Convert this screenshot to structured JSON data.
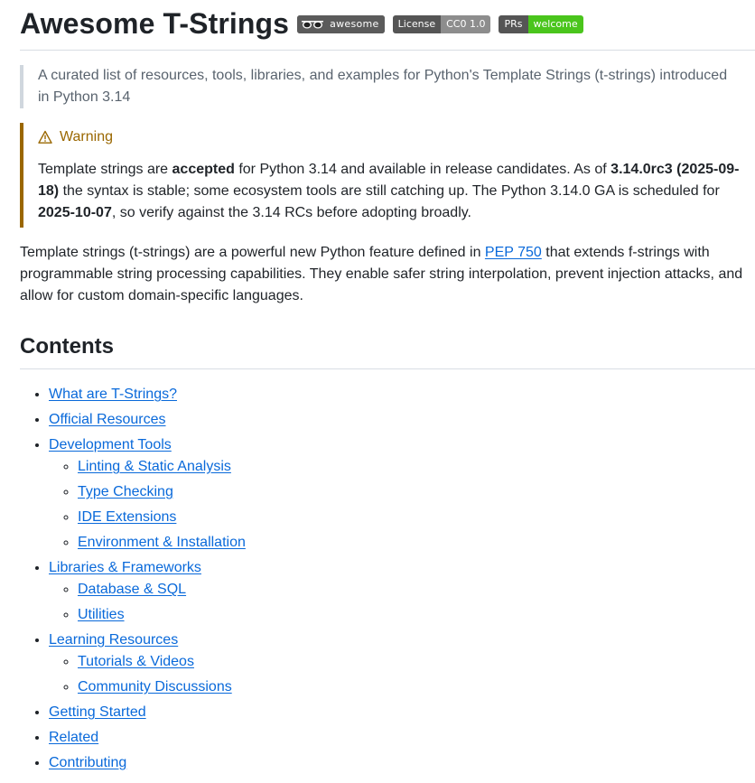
{
  "title": "Awesome T-Strings",
  "badges": [
    {
      "type": "awesome",
      "label": "awesome",
      "icon": "sunglasses-icon"
    },
    {
      "type": "license",
      "left": "License",
      "right": "CC0 1.0",
      "color": "#8d8d8d"
    },
    {
      "type": "prs",
      "left": "PRs",
      "right": "welcome",
      "color": "#4ac51c"
    }
  ],
  "intro": "A curated list of resources, tools, libraries, and examples for Python's Template Strings (t-strings) introduced in Python 3.14",
  "warning": {
    "title": "Warning",
    "t1": "Template strings are ",
    "b1": "accepted",
    "t2": " for Python 3.14 and available in release candidates. As of ",
    "b2": "3.14.0rc3 (2025-09-18)",
    "t3": " the syntax is stable; some ecosystem tools are still catching up. The Python 3.14.0 GA is scheduled for ",
    "b3": "2025-10-07",
    "t4": ", so verify against the 3.14 RCs before adopting broadly."
  },
  "description": {
    "before": "Template strings (t-strings) are a powerful new Python feature defined in ",
    "link": "PEP 750",
    "after": " that extends f-strings with programmable string processing capabilities. They enable safer string interpolation, prevent injection attacks, and allow for custom domain-specific languages."
  },
  "contents_heading": "Contents",
  "toc": {
    "what": "What are T-Strings?",
    "official": "Official Resources",
    "devtools": "Development Tools",
    "linting": "Linting & Static Analysis",
    "typecheck": "Type Checking",
    "ide": "IDE Extensions",
    "env": "Environment & Installation",
    "libs": "Libraries & Frameworks",
    "db": "Database & SQL",
    "utils": "Utilities",
    "learning": "Learning Resources",
    "tutorials": "Tutorials & Videos",
    "community": "Community Discussions",
    "started": "Getting Started",
    "related": "Related",
    "contributing": "Contributing"
  }
}
